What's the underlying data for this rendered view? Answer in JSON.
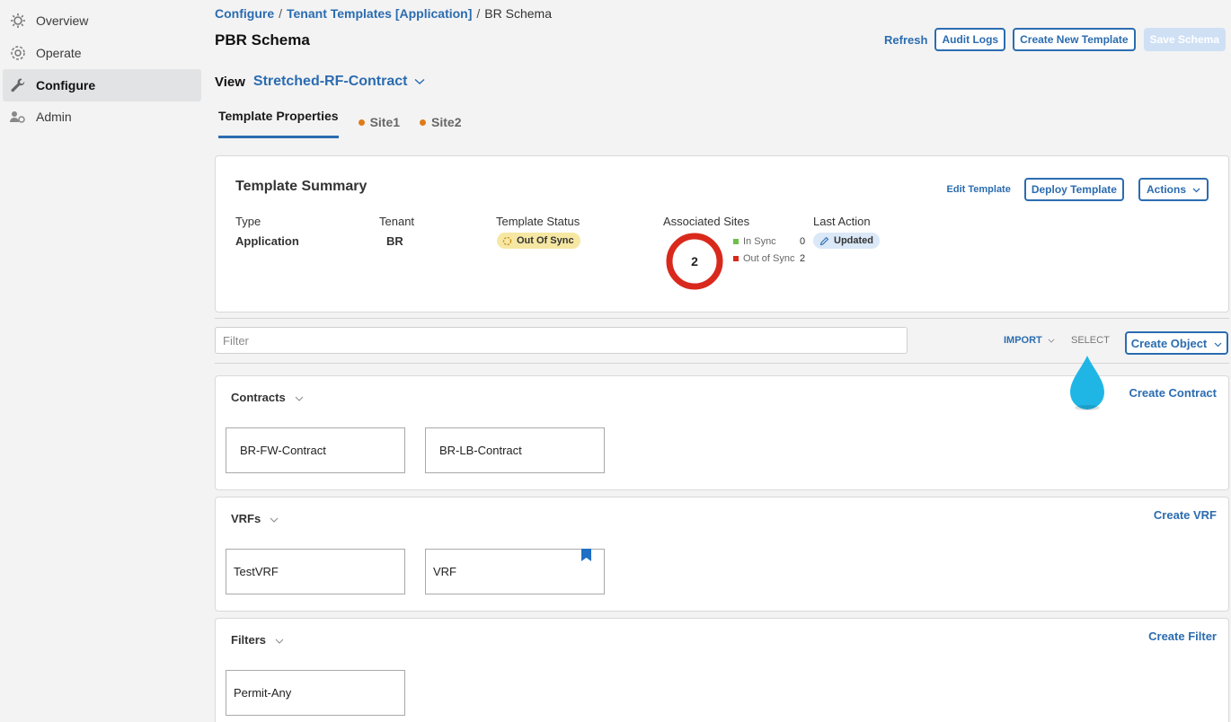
{
  "sidebar": {
    "items": [
      {
        "label": "Overview",
        "icon": "overview-icon"
      },
      {
        "label": "Operate",
        "icon": "operate-icon"
      },
      {
        "label": "Configure",
        "icon": "wrench-icon",
        "active": true
      },
      {
        "label": "Admin",
        "icon": "admin-users-icon"
      }
    ]
  },
  "breadcrumb": {
    "items": [
      "Configure",
      "Tenant Templates [Application]"
    ],
    "current": "BR Schema",
    "separator": "/"
  },
  "page": {
    "title": "PBR Schema"
  },
  "header_actions": {
    "refresh": "Refresh",
    "audit_logs": "Audit Logs",
    "create_template": "Create New Template",
    "save_schema": "Save Schema"
  },
  "view": {
    "label": "View",
    "value": "Stretched-RF-Contract"
  },
  "tabs": [
    {
      "label": "Template Properties",
      "active": true
    },
    {
      "label": "Site1",
      "dot_color": "#e07b1a"
    },
    {
      "label": "Site2",
      "dot_color": "#e07b1a"
    }
  ],
  "summary": {
    "title": "Template Summary",
    "edit_template": "Edit Template",
    "deploy_template": "Deploy Template",
    "actions": "Actions",
    "type": {
      "label": "Type",
      "value": "Application"
    },
    "tenant": {
      "label": "Tenant",
      "value": "BR"
    },
    "status": {
      "label": "Template Status",
      "value": "Out Of Sync",
      "color": "#f6e7a3"
    },
    "associated_sites": {
      "label": "Associated Sites",
      "total": "2",
      "in_sync": {
        "label": "In Sync",
        "count": "0",
        "color": "#6cc04a"
      },
      "out_of_sync": {
        "label": "Out of Sync",
        "count": "2",
        "color": "#d9291c"
      }
    },
    "last_action": {
      "label": "Last Action",
      "value": "Updated"
    }
  },
  "filter_bar": {
    "placeholder": "Filter",
    "import": "IMPORT",
    "select": "SELECT",
    "create_object": "Create Object"
  },
  "sections": {
    "contracts": {
      "title": "Contracts",
      "create": "Create Contract",
      "items": [
        "BR-FW-Contract",
        "BR-LB-Contract"
      ]
    },
    "vrfs": {
      "title": "VRFs",
      "create": "Create VRF",
      "items": [
        "TestVRF",
        "VRF"
      ]
    },
    "filters": {
      "title": "Filters",
      "create": "Create Filter",
      "items": [
        "Permit-Any"
      ]
    }
  },
  "colors": {
    "accent": "#2b6cb0",
    "drop": "#1fb6e6"
  }
}
